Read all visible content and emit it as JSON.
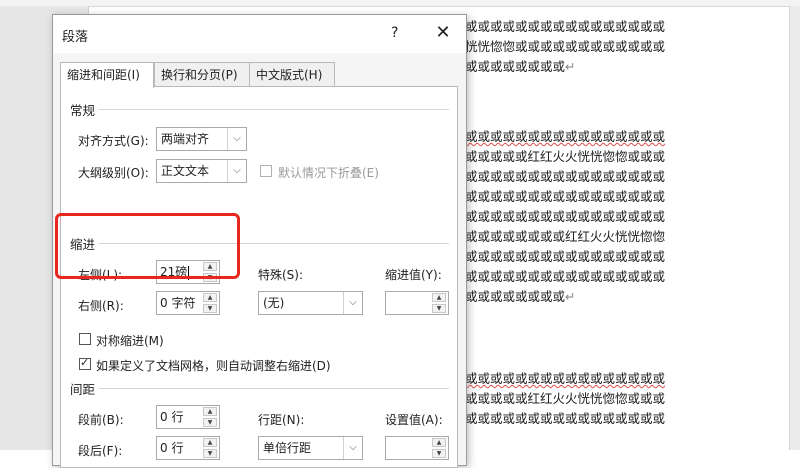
{
  "document": {
    "lines": [
      "或或或或或或或或或或或或或或或或",
      "恍恍惚惚或或或或或或或或或或或或",
      "或或或或或或或或",
      "或或或或或或或或或或或或或或或或",
      "或或或或或红红火火恍恍惚惚或或或",
      "或或或或或或或或或或或或或或或或",
      "或或或或或或或或或或或或或或或或",
      "或或或或或或或或或或或或或或或或",
      "或或或或或或或或红红火火恍恍惚惚",
      "或或或或或或或或或或或或或或或或",
      "或或或或或或或或或或或或或或或或",
      "或或或或或或或或",
      "或或或或或或或或或或或或或或或或",
      "或或或或或红红火火恍恍惚惚或或或",
      "或或或或或或或或或或或或或或或或"
    ],
    "paragraph_mark": "↵"
  },
  "dialog": {
    "title": "段落",
    "help_label": "?",
    "close_label": "✕",
    "tabs": [
      "缩进和间距(I)",
      "换行和分页(P)",
      "中文版式(H)"
    ],
    "general": {
      "heading": "常规",
      "alignment_label": "对齐方式(G):",
      "alignment_value": "两端对齐",
      "outline_label": "大纲级别(O):",
      "outline_value": "正文文本",
      "collapse_label": "默认情况下折叠(E)"
    },
    "indent": {
      "heading": "缩进",
      "left_label": "左侧(L):",
      "left_value": "21磅",
      "right_label": "右侧(R):",
      "right_value": "0 字符",
      "special_label": "特殊(S):",
      "special_value": "(无)",
      "by_label": "缩进值(Y):",
      "by_value": "",
      "mirror_label": "对称缩进(M)",
      "auto_adjust_label": "如果定义了文档网格，则自动调整右缩进(D)"
    },
    "spacing": {
      "heading": "间距",
      "before_label": "段前(B):",
      "before_value": "0 行",
      "after_label": "段后(F):",
      "after_value": "0 行",
      "line_spacing_label": "行距(N):",
      "line_spacing_value": "单倍行距",
      "at_label": "设置值(A):",
      "at_value": ""
    }
  },
  "colors": {
    "highlight": "#e8281e",
    "spell_underline": "#e24b4b"
  }
}
